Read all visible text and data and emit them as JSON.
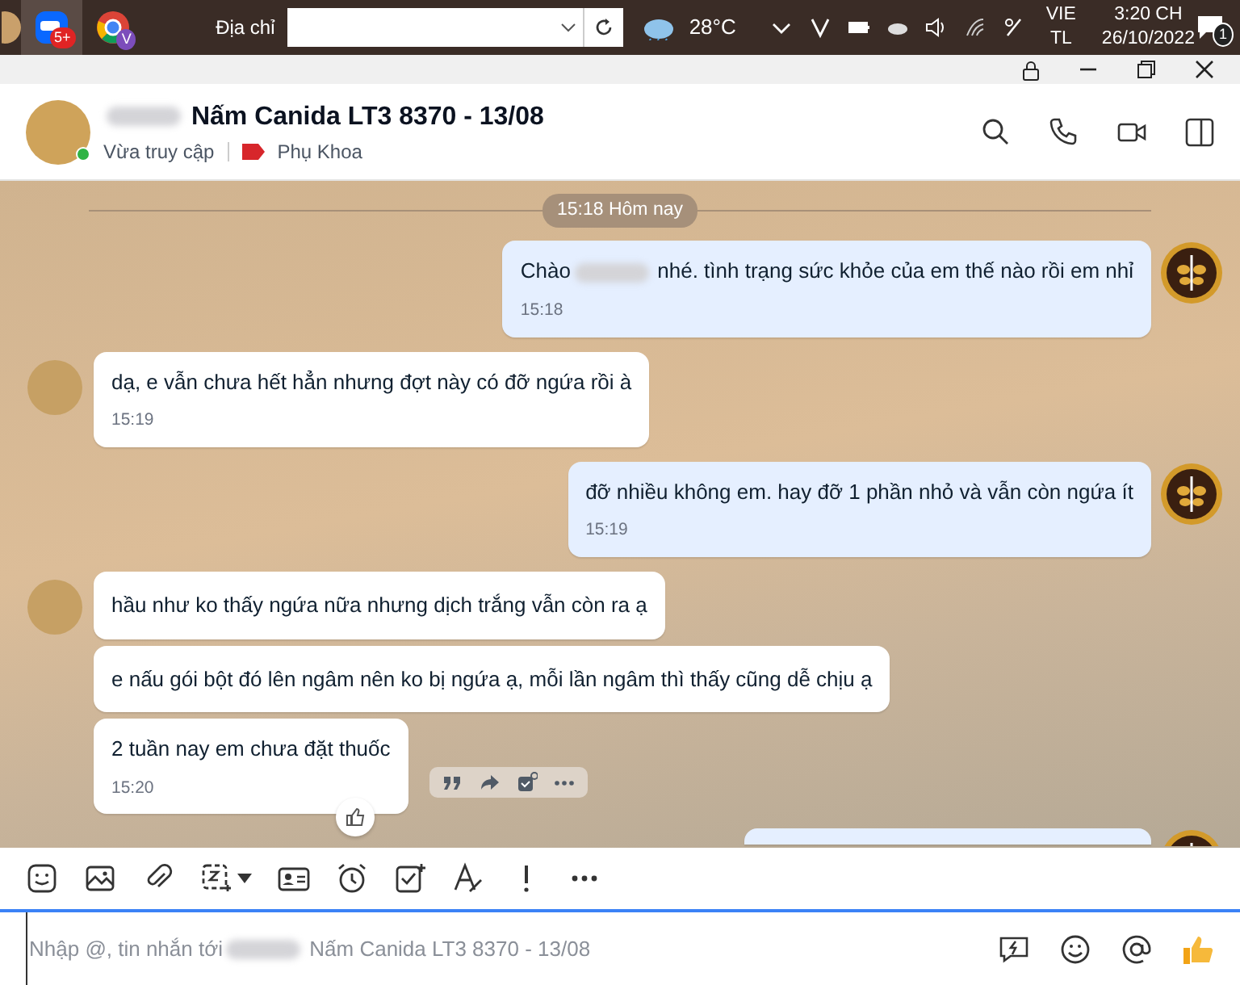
{
  "taskbar": {
    "zalo_badge": "5+",
    "chrome_badge": "V",
    "address_label": "Địa chỉ",
    "weather_temp": "28°C",
    "language_top": "VIE",
    "language_bottom": "TL",
    "time": "3:20 CH",
    "date": "26/10/2022",
    "notification_count": "1"
  },
  "header": {
    "title_segments": [
      {
        "kind": "redacted"
      },
      {
        "kind": "text",
        "text": "Nấm Canida LT3 8370 - 13/08"
      }
    ],
    "status": "Vừa truy cập",
    "tag": "Phụ Khoa",
    "online": true
  },
  "date_divider": "15:18 Hôm nay",
  "messages": [
    {
      "kind": "text",
      "outgoing": true,
      "show_avatar": true,
      "segments": [
        {
          "kind": "text",
          "text": "Chào"
        },
        {
          "kind": "redacted"
        },
        {
          "kind": "text",
          "text": "nhé. tình trạng sức khỏe của em thế nào rồi em nhỉ"
        }
      ],
      "time": "15:18",
      "hovered": false
    },
    {
      "kind": "text",
      "outgoing": false,
      "show_avatar": true,
      "segments": [
        {
          "kind": "text",
          "text": "dạ, e vẫn chưa hết hẳn nhưng đợt này có đỡ ngứa rồi à"
        }
      ],
      "time": "15:19",
      "hovered": false
    },
    {
      "kind": "text",
      "outgoing": true,
      "show_avatar": true,
      "segments": [
        {
          "kind": "text",
          "text": "đỡ nhiều không em. hay đỡ 1 phần nhỏ và vẫn còn ngứa ít"
        }
      ],
      "time": "15:19",
      "hovered": false
    },
    {
      "kind": "text",
      "outgoing": false,
      "show_avatar": true,
      "segments": [
        {
          "kind": "text",
          "text": "hầu như ko thấy ngứa nữa nhưng dịch trắng vẫn còn ra ạ"
        }
      ],
      "hovered": false
    },
    {
      "kind": "text",
      "outgoing": false,
      "show_avatar": false,
      "segments": [
        {
          "kind": "text",
          "text": "e nấu gói bột đó lên ngâm nên ko bị ngứa ạ, mỗi lần ngâm thì thấy cũng dễ chịu ạ"
        }
      ],
      "hovered": false
    },
    {
      "kind": "text",
      "outgoing": false,
      "show_avatar": false,
      "segments": [
        {
          "kind": "text",
          "text": "2 tuần nay em chưa đặt thuốc"
        }
      ],
      "time": "15:20",
      "hovered": true
    },
    {
      "kind": "cut-off",
      "outgoing": true,
      "show_avatar": true,
      "hovered": false
    }
  ],
  "composer": {
    "tools": [
      {
        "kind": "sticker"
      },
      {
        "kind": "image"
      },
      {
        "kind": "attach"
      },
      {
        "kind": "screenshot",
        "has_dropdown": true
      },
      {
        "kind": "contact-card"
      },
      {
        "kind": "reminder"
      },
      {
        "kind": "task"
      },
      {
        "kind": "format"
      },
      {
        "kind": "important"
      },
      {
        "kind": "more"
      }
    ],
    "placeholder_segments": [
      {
        "kind": "text",
        "text": "Nhập @, tin nhắn tới"
      },
      {
        "kind": "redacted"
      },
      {
        "kind": "text",
        "text": "Nấm Canida LT3 8370 - 13/08"
      }
    ],
    "actions": [
      {
        "kind": "quick-message"
      },
      {
        "kind": "emoji"
      },
      {
        "kind": "mention"
      },
      {
        "kind": "like"
      }
    ]
  }
}
